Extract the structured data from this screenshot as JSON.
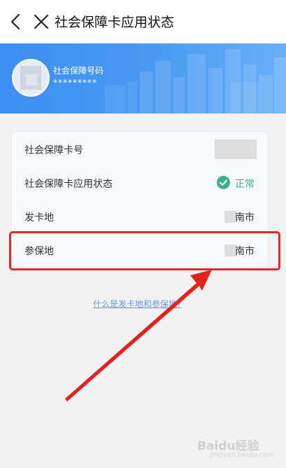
{
  "header": {
    "title": "社会保障卡应用状态",
    "back_icon": "chevron-left-icon",
    "close_icon": "close-icon"
  },
  "banner": {
    "card_label": "社会保障号码",
    "card_number": "*********",
    "accent_color": "#3d8ef1"
  },
  "details": {
    "rows": [
      {
        "label": "社会保障卡号",
        "value": ""
      },
      {
        "label": "社会保障卡应用状态",
        "value": "正常"
      },
      {
        "label": "发卡地",
        "value": "南市"
      },
      {
        "label": "参保地",
        "value": "南市"
      }
    ],
    "status_color": "#3cb08c"
  },
  "help": {
    "link_text": "什么是发卡地和参保地?"
  },
  "annotation": {
    "highlight_color": "#e22a25"
  },
  "watermark": {
    "brand": "Baidu经验",
    "url": "jingyan.baidu.com"
  }
}
